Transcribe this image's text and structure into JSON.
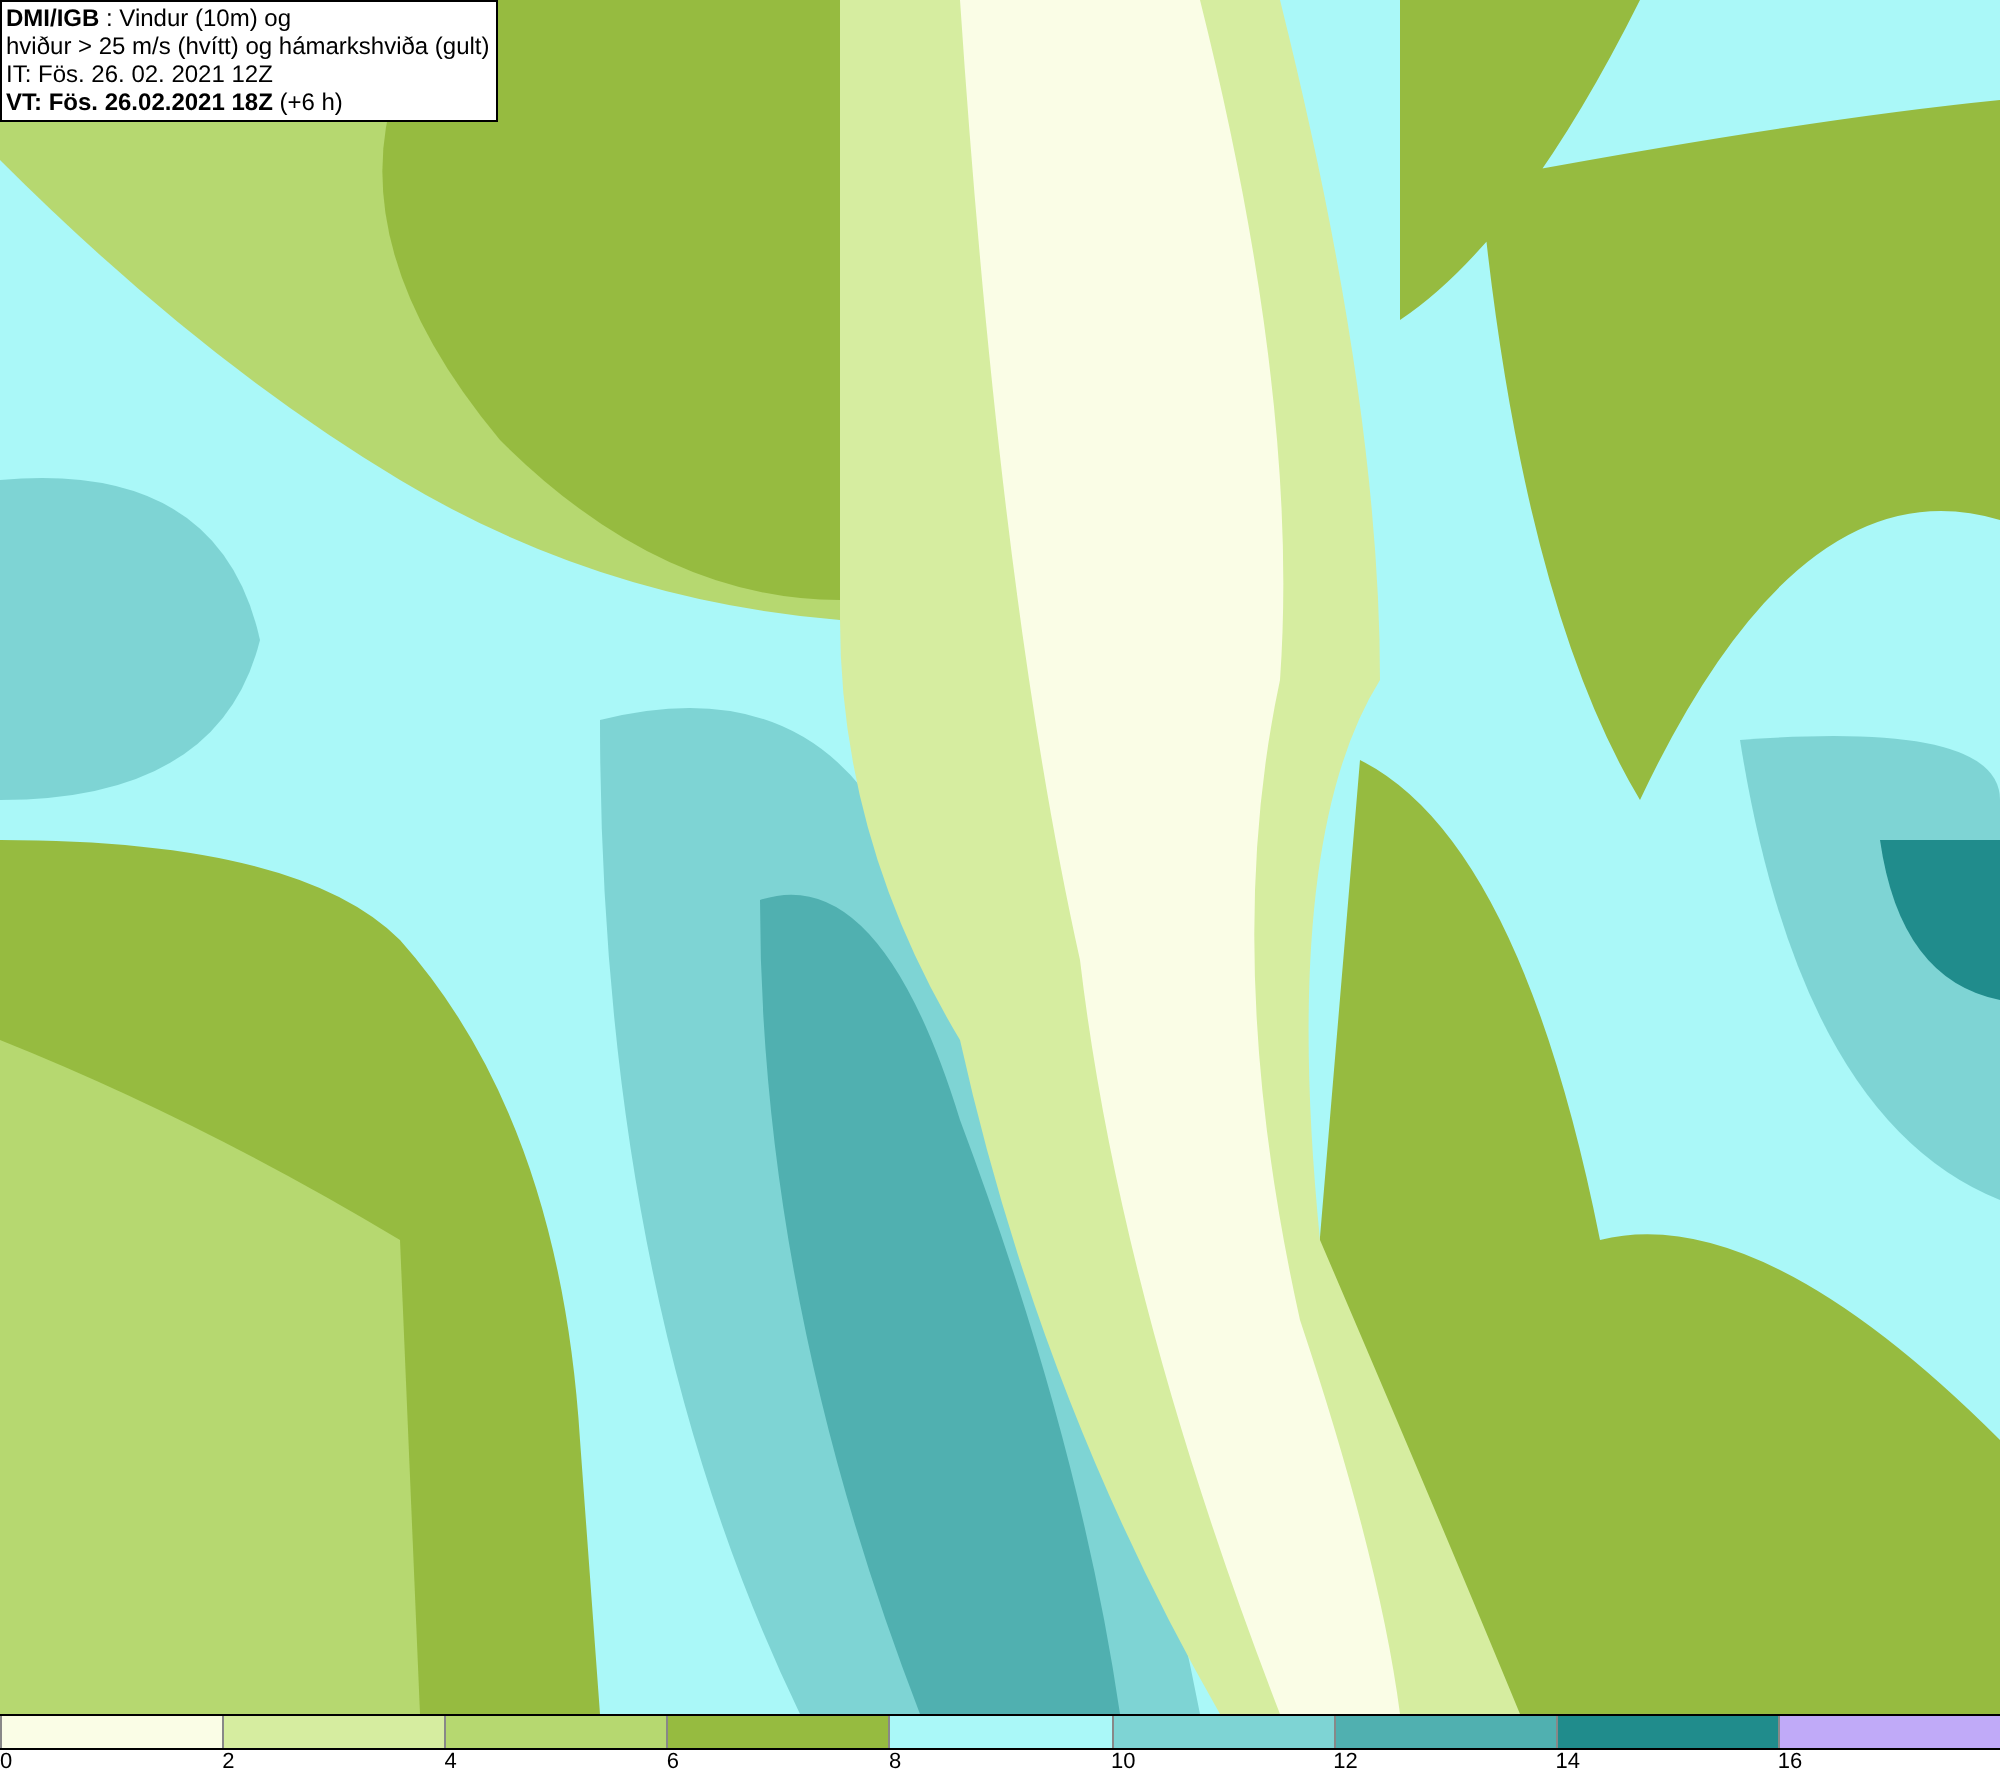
{
  "header": {
    "lines": [
      "**DMI/IGB** : Vindur (10m) og",
      "hviður > 25 m/s (hvítt) og hámarkshviða (gult)",
      "IT: Fös. 26. 02. 2021 12Z",
      "**VT: Fös. 26.02.2021 18Z** (+6 h)"
    ]
  },
  "legend": {
    "bins": [
      {
        "label": "0",
        "color": "#fafde6"
      },
      {
        "label": "2",
        "color": "#d6eda0"
      },
      {
        "label": "4",
        "color": "#b6d870"
      },
      {
        "label": "6",
        "color": "#96bb40"
      },
      {
        "label": "8",
        "color": "#aaf8f8"
      },
      {
        "label": "10",
        "color": "#7ed4d4"
      },
      {
        "label": "12",
        "color": "#50b0b0"
      },
      {
        "label": "14",
        "color": "#208c8c"
      },
      {
        "label": "16",
        "color": "#c0aaf8"
      }
    ]
  }
}
